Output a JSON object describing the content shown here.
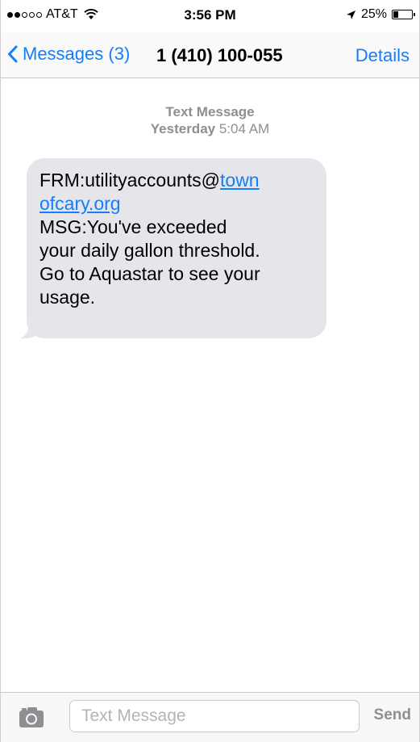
{
  "status_bar": {
    "carrier": "AT&T",
    "time": "3:56 PM",
    "battery": "25%",
    "battery_level": 0.25,
    "signal_bars_filled": 2,
    "signal_bars_total": 5
  },
  "nav": {
    "back_label": "Messages (3)",
    "title": "1 (410) 100-055",
    "details_label": "Details"
  },
  "conversation": {
    "header_type": "Text Message",
    "header_day": "Yesterday",
    "header_time": "5:04 AM",
    "message": {
      "line1_prefix": "FRM:utilityaccounts@",
      "line1_link": "town",
      "line2_link": "ofcary.org",
      "line3": "MSG:You've exceeded",
      "line4": "your daily gallon threshold.",
      "line5": "Go to Aquastar to see your",
      "line6": "usage."
    }
  },
  "input_bar": {
    "placeholder": "Text Message",
    "send_label": "Send"
  },
  "colors": {
    "accent": "#147efb",
    "bubble": "#e5e5ea",
    "muted": "#8e8e93"
  },
  "icons": {
    "wifi": "wifi-icon",
    "location": "location-arrow-icon",
    "battery": "battery-icon",
    "back": "chevron-left-icon",
    "camera": "camera-icon"
  }
}
